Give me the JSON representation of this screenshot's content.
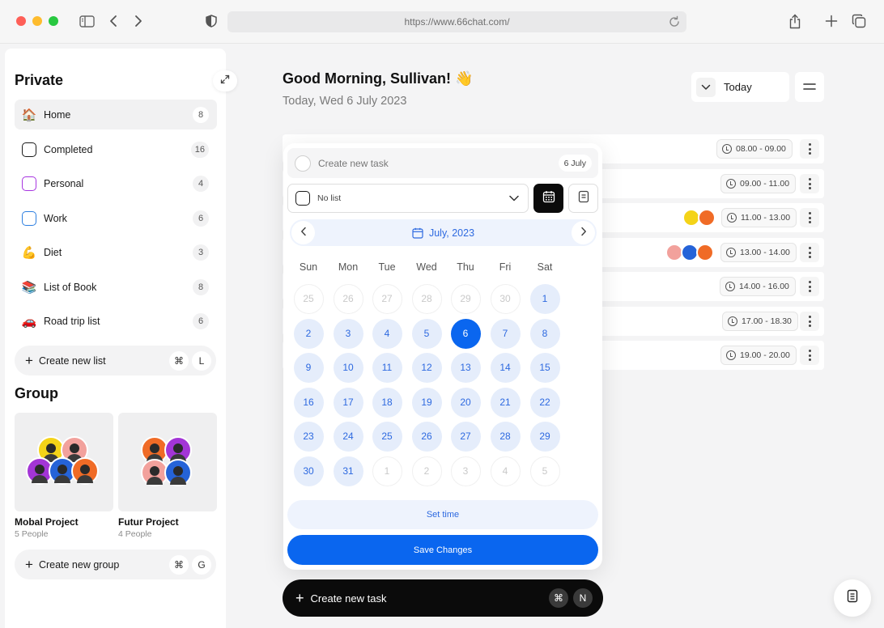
{
  "browser": {
    "url": "https://www.66chat.com/"
  },
  "sidebar": {
    "private_title": "Private",
    "items": [
      {
        "label": "Home",
        "count": "8",
        "icon": "house-emoji"
      },
      {
        "label": "Completed",
        "count": "16",
        "icon": "square-checkbox",
        "color": "#1a1a1a"
      },
      {
        "label": "Personal",
        "count": "4",
        "icon": "square-checkbox",
        "color": "#a735e0"
      },
      {
        "label": "Work",
        "count": "6",
        "icon": "square-checkbox",
        "color": "#2d7fe0"
      },
      {
        "label": "Diet",
        "count": "3",
        "icon": "flexed-biceps-emoji"
      },
      {
        "label": "List of Book",
        "count": "8",
        "icon": "books-emoji"
      },
      {
        "label": "Road trip list",
        "count": "6",
        "icon": "car-emoji"
      }
    ],
    "create_list": {
      "label": "Create new list",
      "key1": "⌘",
      "key2": "L"
    },
    "group_title": "Group",
    "groups": [
      {
        "name": "Mobal Project",
        "people": "5 People"
      },
      {
        "name": "Futur Project",
        "people": "4 People"
      }
    ],
    "create_group": {
      "label": "Create new group",
      "key1": "⌘",
      "key2": "G"
    }
  },
  "header": {
    "greeting": "Good Morning, Sullivan! 👋",
    "date": "Today, Wed 6 July 2023",
    "view_label": "Today"
  },
  "tasks": [
    {
      "time": "08.00 - 09.00"
    },
    {
      "time": "09.00 - 11.00"
    },
    {
      "time": "11.00 - 13.00",
      "avatars": 2
    },
    {
      "time": "13.00 - 14.00",
      "avatars": 3
    },
    {
      "time": "14.00 - 16.00"
    },
    {
      "time": "17.00 - 18.30"
    },
    {
      "time": "19.00 - 20.00"
    }
  ],
  "popup": {
    "task_placeholder": "Create new task",
    "task_date": "6 July",
    "list_value": "No list",
    "month_label": "July, 2023",
    "weekdays": [
      "Sun",
      "Mon",
      "Tue",
      "Wed",
      "Thu",
      "Fri",
      "Sat"
    ],
    "weeks": [
      [
        "25",
        "26",
        "27",
        "28",
        "29",
        "30",
        "1"
      ],
      [
        "2",
        "3",
        "4",
        "5",
        "6",
        "7",
        "8"
      ],
      [
        "9",
        "10",
        "11",
        "12",
        "13",
        "14",
        "15"
      ],
      [
        "16",
        "17",
        "18",
        "19",
        "20",
        "21",
        "22"
      ],
      [
        "23",
        "24",
        "25",
        "26",
        "27",
        "28",
        "29"
      ],
      [
        "30",
        "31",
        "1",
        "2",
        "3",
        "4",
        "5"
      ]
    ],
    "selected_day": "6",
    "set_time_label": "Set time",
    "save_label": "Save Changes"
  },
  "bottom_bar": {
    "label": "Create new task",
    "key1": "⌘",
    "key2": "N"
  },
  "colors": {
    "accent": "#0a66ef",
    "accent_light": "#e5edfb",
    "dark": "#0b0b0b"
  }
}
